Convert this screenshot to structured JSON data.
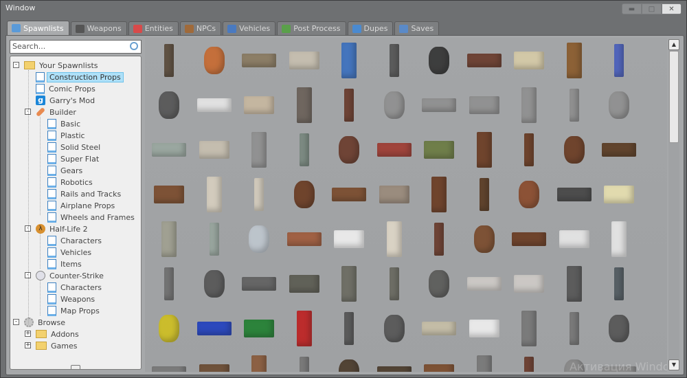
{
  "window": {
    "title": "Window",
    "controls": [
      "minimize",
      "maximize",
      "close"
    ]
  },
  "tabs": [
    {
      "label": "Spawnlists",
      "icon": "spawnlist-icon",
      "color": "#5a9ad8",
      "active": true
    },
    {
      "label": "Weapons",
      "icon": "pistol-icon",
      "color": "#555555"
    },
    {
      "label": "Entities",
      "icon": "cubes-icon",
      "color": "#d84a4a"
    },
    {
      "label": "NPCs",
      "icon": "monkey-icon",
      "color": "#a06a3a"
    },
    {
      "label": "Vehicles",
      "icon": "car-icon",
      "color": "#4a7ac0"
    },
    {
      "label": "Post Process",
      "icon": "picture-icon",
      "color": "#5aa04a"
    },
    {
      "label": "Dupes",
      "icon": "dupes-icon",
      "color": "#4a8ad0"
    },
    {
      "label": "Saves",
      "icon": "saves-icon",
      "color": "#5a8ac8"
    }
  ],
  "search": {
    "placeholder": "Search..."
  },
  "tree": [
    {
      "label": "Your Spawnlists",
      "icon": "folder",
      "depth": 0,
      "exp": "-"
    },
    {
      "label": "Construction Props",
      "icon": "doc",
      "depth": 1,
      "selected": true
    },
    {
      "label": "Comic Props",
      "icon": "doc",
      "depth": 1
    },
    {
      "label": "Garry's Mod",
      "icon": "gmod",
      "depth": 1
    },
    {
      "label": "Builder",
      "icon": "wrench",
      "depth": 1,
      "exp": "-"
    },
    {
      "label": "Basic",
      "icon": "doc",
      "depth": 2
    },
    {
      "label": "Plastic",
      "icon": "doc",
      "depth": 2
    },
    {
      "label": "Solid Steel",
      "icon": "doc",
      "depth": 2
    },
    {
      "label": "Super Flat",
      "icon": "doc",
      "depth": 2
    },
    {
      "label": "Gears",
      "icon": "doc",
      "depth": 2
    },
    {
      "label": "Robotics",
      "icon": "doc",
      "depth": 2
    },
    {
      "label": "Rails and Tracks",
      "icon": "doc",
      "depth": 2
    },
    {
      "label": "Airplane Props",
      "icon": "doc",
      "depth": 2
    },
    {
      "label": "Wheels and Frames",
      "icon": "doc",
      "depth": 2
    },
    {
      "label": "Half-Life 2",
      "icon": "hl2",
      "depth": 1,
      "exp": "-"
    },
    {
      "label": "Characters",
      "icon": "doc",
      "depth": 2
    },
    {
      "label": "Vehicles",
      "icon": "doc",
      "depth": 2
    },
    {
      "label": "Items",
      "icon": "doc",
      "depth": 2
    },
    {
      "label": "Counter-Strike",
      "icon": "cs",
      "depth": 1,
      "exp": "-"
    },
    {
      "label": "Characters",
      "icon": "doc",
      "depth": 2
    },
    {
      "label": "Weapons",
      "icon": "doc",
      "depth": 2
    },
    {
      "label": "Map Props",
      "icon": "doc",
      "depth": 2
    },
    {
      "label": "Browse",
      "icon": "gear",
      "depth": 0,
      "exp": "-"
    },
    {
      "label": "Addons",
      "icon": "folder",
      "depth": 1,
      "exp": "+"
    },
    {
      "label": "Games",
      "icon": "folder",
      "depth": 1,
      "exp": "+"
    }
  ],
  "props": {
    "colors": [
      "#5a4a3a",
      "#c86a30",
      "#8a7a60",
      "#c8c0b0",
      "#3a70c0",
      "#555555",
      "#333333",
      "#6a3a2a",
      "#d8cca8",
      "#8a5a2a",
      "#4a60c0",
      "#555555",
      "#e8e8e8",
      "#c8b8a0",
      "#6a6058",
      "#6a3a2a",
      "#909090",
      "#909090",
      "#909090",
      "#909090",
      "#909090",
      "#909090",
      "#9aa8a0",
      "#c8c0b0",
      "#909090",
      "#7a8a80",
      "#6a3a2a",
      "#a03a30",
      "#6a7a40",
      "#6a3a20",
      "#6a3a20",
      "#6a3a20",
      "#5a3a20",
      "#7a4a2a",
      "#d8d0c0",
      "#d8d0c0",
      "#6a3a20",
      "#7a4a2a",
      "#9a8a7a",
      "#6a3a20",
      "#5a3a20",
      "#8a4a2a",
      "#444444",
      "#e8e0b0",
      "#a0a090",
      "#9aa8a0",
      "#c0c8d0",
      "#a05a3a",
      "#f0f0f0",
      "#e0d8c8",
      "#6a3a2a",
      "#7a4a2a",
      "#6a3a20",
      "#e8e8e8",
      "#e8e8e8",
      "#707070",
      "#555555",
      "#606060",
      "#5a5a50",
      "#6a6a60",
      "#6a6a60",
      "#5a5a58",
      "#d0ccc8",
      "#d0ccc8",
      "#555555",
      "#505a60",
      "#d0c020",
      "#2040c0",
      "#208030",
      "#c02020",
      "#555555",
      "#555555",
      "#c8c0a8",
      "#f0f0f0",
      "#777777",
      "#777777",
      "#555555",
      "#777777",
      "#6a4a30",
      "#8a5a3a",
      "#777777",
      "#4a3a2a",
      "#4a3a2a",
      "#7a4a2a",
      "#777777",
      "#6a3a2a",
      "#888888",
      "#888888"
    ]
  },
  "watermark": "Активация Window"
}
